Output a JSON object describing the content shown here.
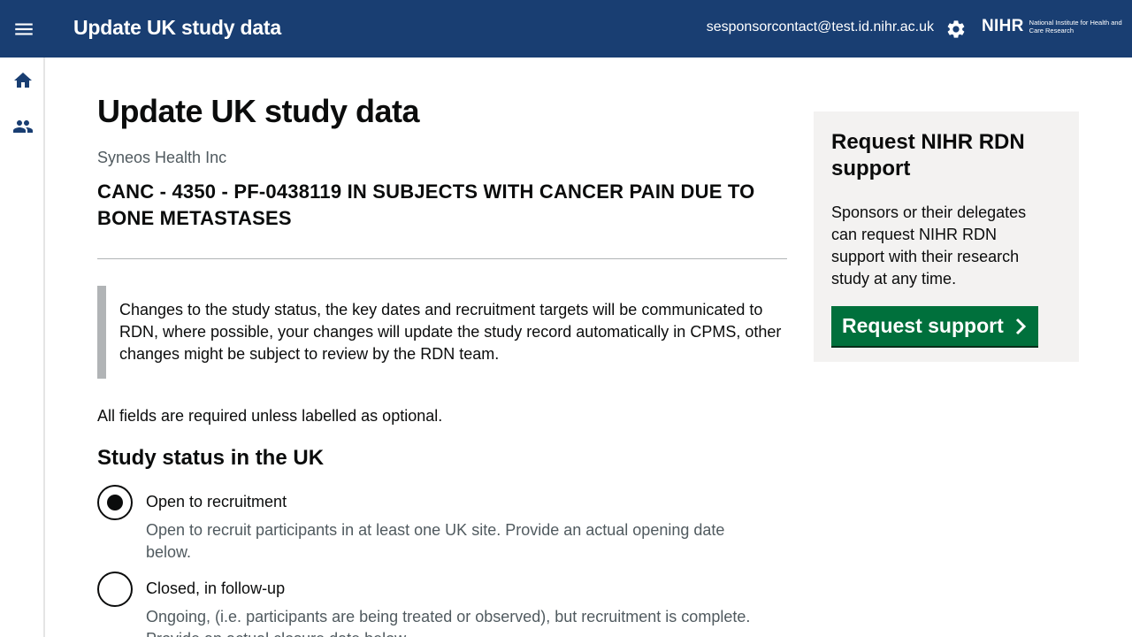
{
  "header": {
    "title": "Update UK study data",
    "user_email": "sesponsorcontact@test.id.nihr.ac.uk",
    "logo_mark": "NIHR",
    "logo_text": "National Institute for Health and Care Research",
    "background_color": "#193e72"
  },
  "icons": {
    "menu": "menu-icon",
    "settings": "gear-icon",
    "home": "home-icon",
    "users": "users-icon",
    "chevron": "chevron-right-icon"
  },
  "main": {
    "page_title": "Update UK study data",
    "organisation": "Syneos Health Inc",
    "study_title": "CANC - 4350 - PF-0438119 IN SUBJECTS WITH CANCER PAIN DUE TO BONE METASTASES",
    "inset_text": "Changes to the study status, the key dates and recruitment targets will be communicated to RDN, where possible, your changes will update the study record automatically in CPMS, other changes might be subject to review by the RDN team.",
    "required_note": "All fields are required unless labelled as optional.",
    "status_heading": "Study status in the UK",
    "status_options": [
      {
        "label": "Open to recruitment",
        "hint": "Open to recruit participants in at least one UK site. Provide an actual opening date below.",
        "checked": true
      },
      {
        "label": "Closed, in follow-up",
        "hint": "Ongoing, (i.e. participants are being treated or observed), but recruitment is complete. Provide an actual closure date below.",
        "checked": false
      }
    ]
  },
  "aside": {
    "title": "Request NIHR RDN support",
    "text": "Sponsors or their delegates can request NIHR RDN support with their research study at any time.",
    "button_label": "Request support",
    "button_color": "#00703c"
  }
}
